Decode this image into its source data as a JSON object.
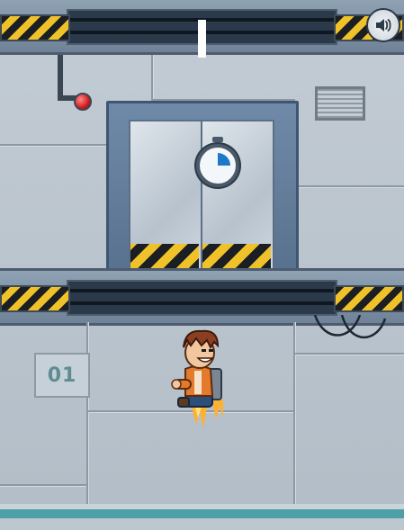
{
  "hud": {
    "sound_icon": "speaker-icon",
    "progress_marker_color": "#ffffff"
  },
  "level": {
    "floor_number": "01"
  },
  "powerup": {
    "icon": "stopwatch-icon",
    "fill_fraction": 0.25,
    "accent": "#1e78c8"
  },
  "player": {
    "character": "jetpack-hero",
    "jacket_color": "#e37a2c",
    "flame_color": "#ffb02e"
  },
  "colors": {
    "hazard_yellow": "#f0c22a",
    "wall": "#b8c3cc",
    "floor_strip": "#4f9fa6"
  }
}
